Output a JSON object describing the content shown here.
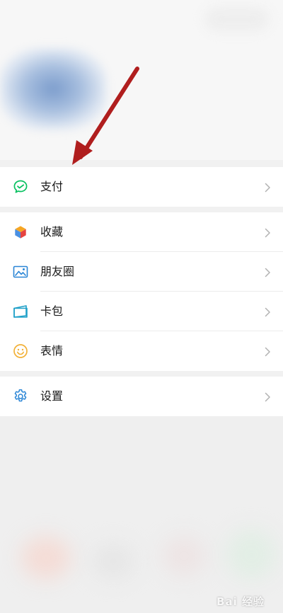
{
  "menu": {
    "pay": {
      "label": "支付",
      "icon": "pay-icon"
    },
    "items": [
      {
        "label": "收藏",
        "icon": "favorites-cube-icon"
      },
      {
        "label": "朋友圈",
        "icon": "moments-photo-icon"
      },
      {
        "label": "卡包",
        "icon": "card-wallet-icon"
      },
      {
        "label": "表情",
        "icon": "sticker-smile-icon"
      }
    ],
    "settings": {
      "label": "设置",
      "icon": "gear-icon"
    }
  },
  "watermark": "Bai 经验",
  "colors": {
    "pay_green": "#07c160",
    "favorites": [
      "#f6a623",
      "#4a90e2",
      "#e64340"
    ],
    "moments": "#2b86d6",
    "card": "#1fa0c8",
    "sticker": "#f2b138",
    "settings": "#2b86d6",
    "annotation_arrow": "#b01e1e"
  }
}
